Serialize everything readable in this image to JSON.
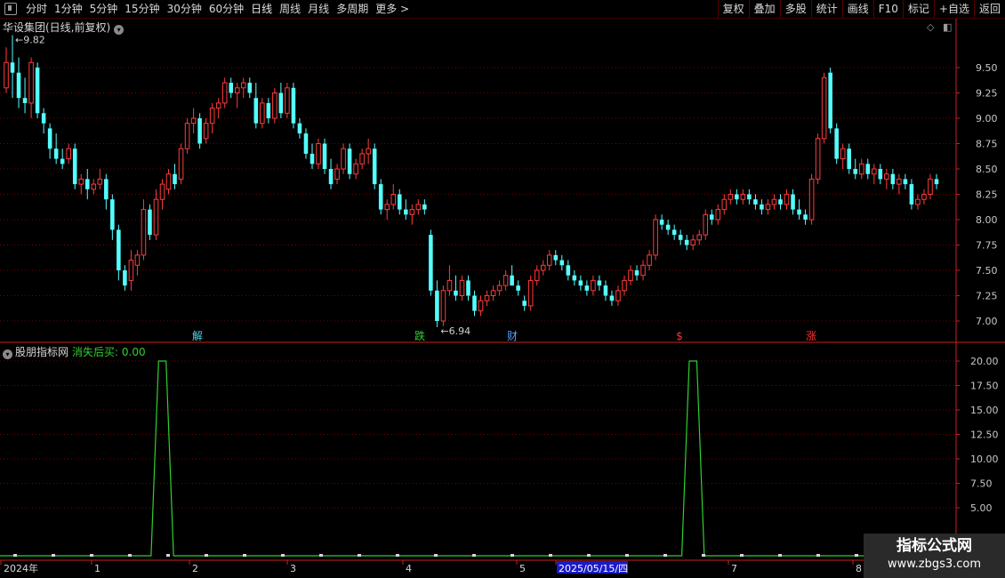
{
  "toolbar": {
    "period_tabs": [
      "分时",
      "1分钟",
      "5分钟",
      "15分钟",
      "30分钟",
      "60分钟",
      "日线",
      "周线",
      "月线",
      "多周期",
      "更多 >"
    ],
    "active_tab": "日线",
    "actions": [
      "复权",
      "叠加",
      "多股",
      "统计",
      "画线",
      "F10",
      "标记",
      "+自选",
      "返回"
    ]
  },
  "main_chart": {
    "title": "华设集团(日线,前复权)",
    "high_label": "9.82",
    "low_label": "6.94",
    "price_axis": [
      "9.50",
      "9.25",
      "9.00",
      "8.75",
      "8.50",
      "8.25",
      "8.00",
      "7.75",
      "7.50",
      "7.25",
      "7.00"
    ],
    "event_markers": [
      {
        "text": "解",
        "color": "#4fd6e6"
      },
      {
        "text": "跌",
        "color": "#2fd02f"
      },
      {
        "text": "财",
        "color": "#4f9fff"
      },
      {
        "text": "$",
        "color": "#ff3030"
      },
      {
        "text": "涨",
        "color": "#ff3030"
      }
    ],
    "colors": {
      "up": "#ff3b3b",
      "down": "#54ffff",
      "grid": "#7a0000",
      "axis": "#cc2020"
    }
  },
  "indicator": {
    "name": "股朋指标网",
    "value_label": "消失后买: 0.00",
    "axis": [
      "20.00",
      "17.50",
      "15.00",
      "12.50",
      "10.00",
      "7.50",
      "5.00"
    ],
    "line_color": "#2fd02f"
  },
  "date_axis": {
    "labels": [
      "2024年",
      "1",
      "2",
      "3",
      "4",
      "5",
      "2025/05/15/四",
      "7",
      "8"
    ],
    "highlighted": "2025/05/15/四"
  },
  "watermark": {
    "title": "指标公式网",
    "url": "www.zbgs3.com"
  },
  "chart_data": {
    "type": "candlestick",
    "title": "华设集团(日线,前复权)",
    "ylim": [
      6.85,
      9.95
    ],
    "candles": [
      [
        9.3,
        9.7,
        9.25,
        9.55
      ],
      [
        9.55,
        9.82,
        9.2,
        9.45
      ],
      [
        9.45,
        9.6,
        9.1,
        9.2
      ],
      [
        9.2,
        9.4,
        9.05,
        9.15
      ],
      [
        9.15,
        9.6,
        9.0,
        9.55
      ],
      [
        9.5,
        9.55,
        9.0,
        9.05
      ],
      [
        9.05,
        9.1,
        8.85,
        8.95
      ],
      [
        8.9,
        8.95,
        8.6,
        8.7
      ],
      [
        8.7,
        8.85,
        8.55,
        8.6
      ],
      [
        8.6,
        8.7,
        8.5,
        8.55
      ],
      [
        8.6,
        8.75,
        8.55,
        8.7
      ],
      [
        8.7,
        8.75,
        8.3,
        8.35
      ],
      [
        8.35,
        8.45,
        8.25,
        8.4
      ],
      [
        8.4,
        8.5,
        8.2,
        8.3
      ],
      [
        8.3,
        8.4,
        8.25,
        8.35
      ],
      [
        8.35,
        8.5,
        8.3,
        8.4
      ],
      [
        8.4,
        8.45,
        8.1,
        8.2
      ],
      [
        8.2,
        8.25,
        7.8,
        7.9
      ],
      [
        7.9,
        7.95,
        7.4,
        7.5
      ],
      [
        7.5,
        7.55,
        7.3,
        7.35
      ],
      [
        7.4,
        7.7,
        7.3,
        7.6
      ],
      [
        7.55,
        7.7,
        7.45,
        7.65
      ],
      [
        7.65,
        8.2,
        7.6,
        8.1
      ],
      [
        8.1,
        8.15,
        7.8,
        7.85
      ],
      [
        7.85,
        8.3,
        7.8,
        8.2
      ],
      [
        8.2,
        8.4,
        8.1,
        8.35
      ],
      [
        8.3,
        8.5,
        8.25,
        8.45
      ],
      [
        8.45,
        8.55,
        8.3,
        8.35
      ],
      [
        8.4,
        8.75,
        8.35,
        8.7
      ],
      [
        8.7,
        9.0,
        8.65,
        8.95
      ],
      [
        8.95,
        9.1,
        8.85,
        9.0
      ],
      [
        9.0,
        9.05,
        8.7,
        8.75
      ],
      [
        8.8,
        9.0,
        8.75,
        8.95
      ],
      [
        8.95,
        9.15,
        8.85,
        9.1
      ],
      [
        9.1,
        9.2,
        9.0,
        9.15
      ],
      [
        9.15,
        9.4,
        9.1,
        9.35
      ],
      [
        9.35,
        9.4,
        9.2,
        9.25
      ],
      [
        9.25,
        9.35,
        9.1,
        9.3
      ],
      [
        9.3,
        9.4,
        9.2,
        9.35
      ],
      [
        9.35,
        9.4,
        9.2,
        9.25
      ],
      [
        9.2,
        9.35,
        8.9,
        8.95
      ],
      [
        8.95,
        9.2,
        8.9,
        9.15
      ],
      [
        9.15,
        9.2,
        8.95,
        9.0
      ],
      [
        9.0,
        9.3,
        8.95,
        9.25
      ],
      [
        9.25,
        9.35,
        9.0,
        9.05
      ],
      [
        9.05,
        9.35,
        9.0,
        9.3
      ],
      [
        9.3,
        9.35,
        8.9,
        8.95
      ],
      [
        8.95,
        9.0,
        8.8,
        8.85
      ],
      [
        8.85,
        8.9,
        8.6,
        8.65
      ],
      [
        8.65,
        8.75,
        8.5,
        8.55
      ],
      [
        8.55,
        8.8,
        8.5,
        8.75
      ],
      [
        8.75,
        8.8,
        8.45,
        8.5
      ],
      [
        8.5,
        8.6,
        8.3,
        8.35
      ],
      [
        8.4,
        8.55,
        8.35,
        8.5
      ],
      [
        8.5,
        8.75,
        8.45,
        8.7
      ],
      [
        8.7,
        8.75,
        8.4,
        8.45
      ],
      [
        8.45,
        8.6,
        8.4,
        8.55
      ],
      [
        8.55,
        8.7,
        8.5,
        8.65
      ],
      [
        8.65,
        8.8,
        8.55,
        8.7
      ],
      [
        8.7,
        8.75,
        8.3,
        8.35
      ],
      [
        8.35,
        8.4,
        8.05,
        8.1
      ],
      [
        8.1,
        8.2,
        8.0,
        8.15
      ],
      [
        8.15,
        8.35,
        8.1,
        8.25
      ],
      [
        8.25,
        8.3,
        8.05,
        8.1
      ],
      [
        8.1,
        8.2,
        8.0,
        8.05
      ],
      [
        8.05,
        8.15,
        7.95,
        8.1
      ],
      [
        8.1,
        8.2,
        8.05,
        8.15
      ],
      [
        8.15,
        8.2,
        8.05,
        8.1
      ],
      [
        7.85,
        7.9,
        7.25,
        7.3
      ],
      [
        7.3,
        7.4,
        6.94,
        7.0
      ],
      [
        7.0,
        7.35,
        6.95,
        7.3
      ],
      [
        7.3,
        7.55,
        7.25,
        7.4
      ],
      [
        7.3,
        7.45,
        7.2,
        7.25
      ],
      [
        7.25,
        7.45,
        7.2,
        7.4
      ],
      [
        7.4,
        7.45,
        7.2,
        7.25
      ],
      [
        7.25,
        7.3,
        7.05,
        7.1
      ],
      [
        7.1,
        7.25,
        7.05,
        7.2
      ],
      [
        7.2,
        7.3,
        7.15,
        7.25
      ],
      [
        7.25,
        7.35,
        7.2,
        7.3
      ],
      [
        7.3,
        7.4,
        7.25,
        7.35
      ],
      [
        7.35,
        7.5,
        7.3,
        7.45
      ],
      [
        7.45,
        7.55,
        7.4,
        7.35
      ],
      [
        7.35,
        7.4,
        7.25,
        7.3
      ],
      [
        7.2,
        7.25,
        7.1,
        7.15
      ],
      [
        7.15,
        7.45,
        7.1,
        7.4
      ],
      [
        7.4,
        7.55,
        7.35,
        7.5
      ],
      [
        7.5,
        7.6,
        7.45,
        7.55
      ],
      [
        7.55,
        7.7,
        7.5,
        7.65
      ],
      [
        7.65,
        7.7,
        7.55,
        7.6
      ],
      [
        7.6,
        7.65,
        7.5,
        7.55
      ],
      [
        7.55,
        7.6,
        7.4,
        7.45
      ],
      [
        7.45,
        7.5,
        7.35,
        7.4
      ],
      [
        7.4,
        7.45,
        7.3,
        7.35
      ],
      [
        7.35,
        7.4,
        7.25,
        7.3
      ],
      [
        7.3,
        7.45,
        7.25,
        7.4
      ],
      [
        7.4,
        7.45,
        7.3,
        7.35
      ],
      [
        7.35,
        7.4,
        7.2,
        7.25
      ],
      [
        7.25,
        7.3,
        7.15,
        7.2
      ],
      [
        7.2,
        7.35,
        7.15,
        7.3
      ],
      [
        7.3,
        7.45,
        7.25,
        7.4
      ],
      [
        7.4,
        7.55,
        7.35,
        7.5
      ],
      [
        7.5,
        7.55,
        7.4,
        7.45
      ],
      [
        7.45,
        7.6,
        7.4,
        7.55
      ],
      [
        7.55,
        7.7,
        7.5,
        7.65
      ],
      [
        7.65,
        8.05,
        7.6,
        8.0
      ],
      [
        8.0,
        8.05,
        7.9,
        7.95
      ],
      [
        7.95,
        8.0,
        7.85,
        7.9
      ],
      [
        7.9,
        7.95,
        7.8,
        7.85
      ],
      [
        7.85,
        7.9,
        7.75,
        7.8
      ],
      [
        7.8,
        7.85,
        7.7,
        7.75
      ],
      [
        7.75,
        7.85,
        7.7,
        7.8
      ],
      [
        7.8,
        7.9,
        7.75,
        7.85
      ],
      [
        7.85,
        8.1,
        7.8,
        8.05
      ],
      [
        8.05,
        8.1,
        7.95,
        8.0
      ],
      [
        8.0,
        8.15,
        7.95,
        8.1
      ],
      [
        8.1,
        8.25,
        8.05,
        8.2
      ],
      [
        8.2,
        8.3,
        8.15,
        8.25
      ],
      [
        8.25,
        8.3,
        8.15,
        8.2
      ],
      [
        8.2,
        8.3,
        8.15,
        8.25
      ],
      [
        8.25,
        8.3,
        8.15,
        8.2
      ],
      [
        8.2,
        8.25,
        8.1,
        8.15
      ],
      [
        8.15,
        8.2,
        8.05,
        8.1
      ],
      [
        8.1,
        8.2,
        8.05,
        8.15
      ],
      [
        8.15,
        8.25,
        8.1,
        8.2
      ],
      [
        8.2,
        8.25,
        8.1,
        8.15
      ],
      [
        8.15,
        8.3,
        8.1,
        8.25
      ],
      [
        8.25,
        8.3,
        8.05,
        8.1
      ],
      [
        8.1,
        8.2,
        8.0,
        8.05
      ],
      [
        8.05,
        8.1,
        7.95,
        8.0
      ],
      [
        8.0,
        8.45,
        7.95,
        8.4
      ],
      [
        8.4,
        8.85,
        8.35,
        8.8
      ],
      [
        8.8,
        9.45,
        8.75,
        9.4
      ],
      [
        9.45,
        9.5,
        8.85,
        8.9
      ],
      [
        8.9,
        8.95,
        8.55,
        8.6
      ],
      [
        8.6,
        8.75,
        8.5,
        8.7
      ],
      [
        8.7,
        8.75,
        8.45,
        8.5
      ],
      [
        8.5,
        8.6,
        8.4,
        8.45
      ],
      [
        8.45,
        8.6,
        8.4,
        8.55
      ],
      [
        8.55,
        8.6,
        8.4,
        8.45
      ],
      [
        8.45,
        8.55,
        8.35,
        8.5
      ],
      [
        8.5,
        8.55,
        8.35,
        8.4
      ],
      [
        8.4,
        8.5,
        8.3,
        8.45
      ],
      [
        8.45,
        8.5,
        8.3,
        8.35
      ],
      [
        8.35,
        8.45,
        8.25,
        8.4
      ],
      [
        8.4,
        8.45,
        8.3,
        8.35
      ],
      [
        8.35,
        8.4,
        8.1,
        8.15
      ],
      [
        8.15,
        8.25,
        8.1,
        8.2
      ],
      [
        8.2,
        8.3,
        8.15,
        8.25
      ],
      [
        8.25,
        8.45,
        8.2,
        8.4
      ],
      [
        8.4,
        8.45,
        8.3,
        8.35
      ]
    ],
    "indicator_values_note": "spikes to 20 at two points, otherwise 0",
    "indicator_spikes": [
      25,
      110
    ]
  }
}
